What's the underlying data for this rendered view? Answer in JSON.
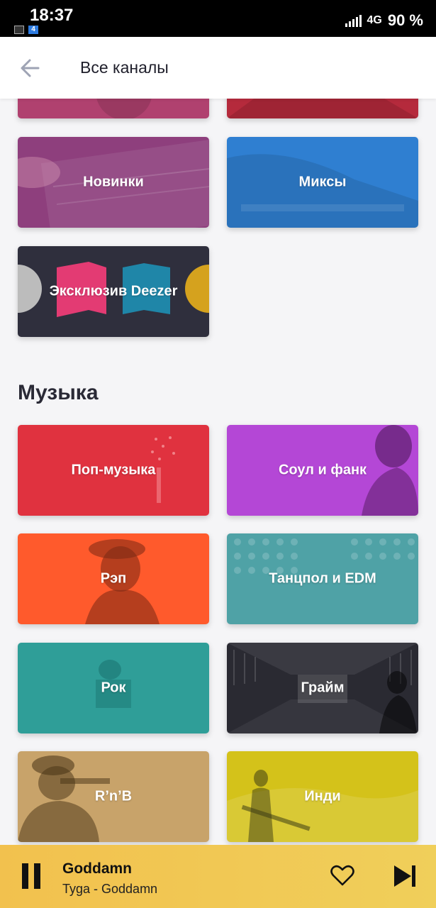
{
  "status_bar": {
    "time": "18:37",
    "network": "4G",
    "battery": "90 %",
    "notification_badge": "4"
  },
  "app_bar": {
    "back_icon": "arrow-left-icon",
    "title": "Все каналы"
  },
  "top_channels": [
    {
      "label": "",
      "color": "#b0416f"
    },
    {
      "label": "",
      "color": "#b52a3c"
    },
    {
      "label": "Новинки",
      "color": "#8e3f7d"
    },
    {
      "label": "Миксы",
      "color": "#2f7fd1"
    },
    {
      "label": "Эксклюзив Deezer",
      "color": "#2f2f3d"
    }
  ],
  "music_section": {
    "title": "Музыка",
    "tiles": [
      {
        "label": "Поп-музыка",
        "color": "#e0323f"
      },
      {
        "label": "Соул и фанк",
        "color": "#b447d6"
      },
      {
        "label": "Рэп",
        "color": "#ff5a2c"
      },
      {
        "label": "Танцпол и EDM",
        "color": "#4fa2a6"
      },
      {
        "label": "Рок",
        "color": "#2f9e98"
      },
      {
        "label": "Грайм",
        "color": "#2a2a32"
      },
      {
        "label": "R’n’B",
        "color": "#c8a36a"
      },
      {
        "label": "Инди",
        "color": "#d4c21a"
      }
    ]
  },
  "player": {
    "track": "Goddamn",
    "artist": "Tyga - Goddamn",
    "pause_icon": "pause-icon",
    "favorite_icon": "heart-icon",
    "next_icon": "skip-next-icon"
  }
}
